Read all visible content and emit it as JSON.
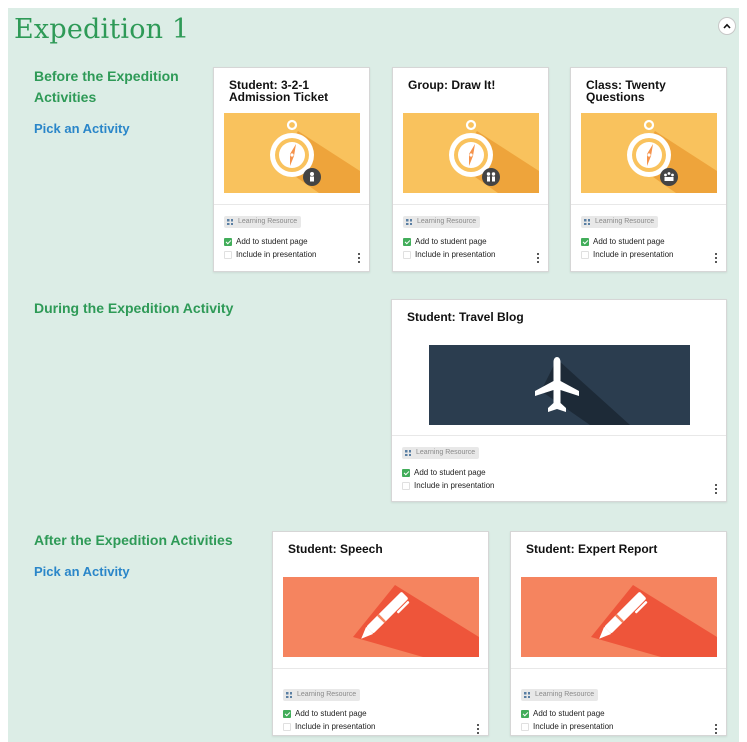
{
  "expedition": {
    "title": "Expedition 1"
  },
  "sections": {
    "before": {
      "label": "Before the Expedition Activities",
      "label_line1": "Before the Expedition",
      "label_line2": "Activities",
      "pick_label": "Pick an Activity"
    },
    "during": {
      "label": "During the Expedition Activity"
    },
    "after": {
      "label": "After the Expedition Activities",
      "pick_label": "Pick an Activity"
    }
  },
  "cards": [
    {
      "title_line1": "Student: 3-2-1",
      "title_line2": "Admission Ticket",
      "image": "compass-icon",
      "sub_icon": "student-icon",
      "color": "#f9c25d"
    },
    {
      "title_line1": "Group: Draw It!",
      "title_line2": "",
      "image": "compass-icon",
      "sub_icon": "group-icon",
      "color": "#f9c25d"
    },
    {
      "title_line1": "Class: Twenty",
      "title_line2": "Questions",
      "image": "compass-icon",
      "sub_icon": "class-icon",
      "color": "#f9c25d"
    },
    {
      "title_line1": "Student: Travel Blog",
      "title_line2": "",
      "image": "airplane-icon",
      "color": "#2b3d4f"
    },
    {
      "title_line1": "Student: Speech",
      "title_line2": "",
      "image": "pen-icon",
      "color": "#f5845f"
    },
    {
      "title_line1": "Student: Expert Report",
      "title_line2": "",
      "image": "pen-icon",
      "color": "#f5845f"
    }
  ],
  "card_common": {
    "badge": "Learning Resource",
    "add_label": "Add to student page",
    "add_checked": true,
    "include_label": "Include in presentation",
    "include_checked": false
  },
  "colors": {
    "panel_bg": "#dcede6",
    "section_green": "#2e9a57",
    "link_blue": "#2a86c9",
    "check_green": "#42ad5a"
  }
}
